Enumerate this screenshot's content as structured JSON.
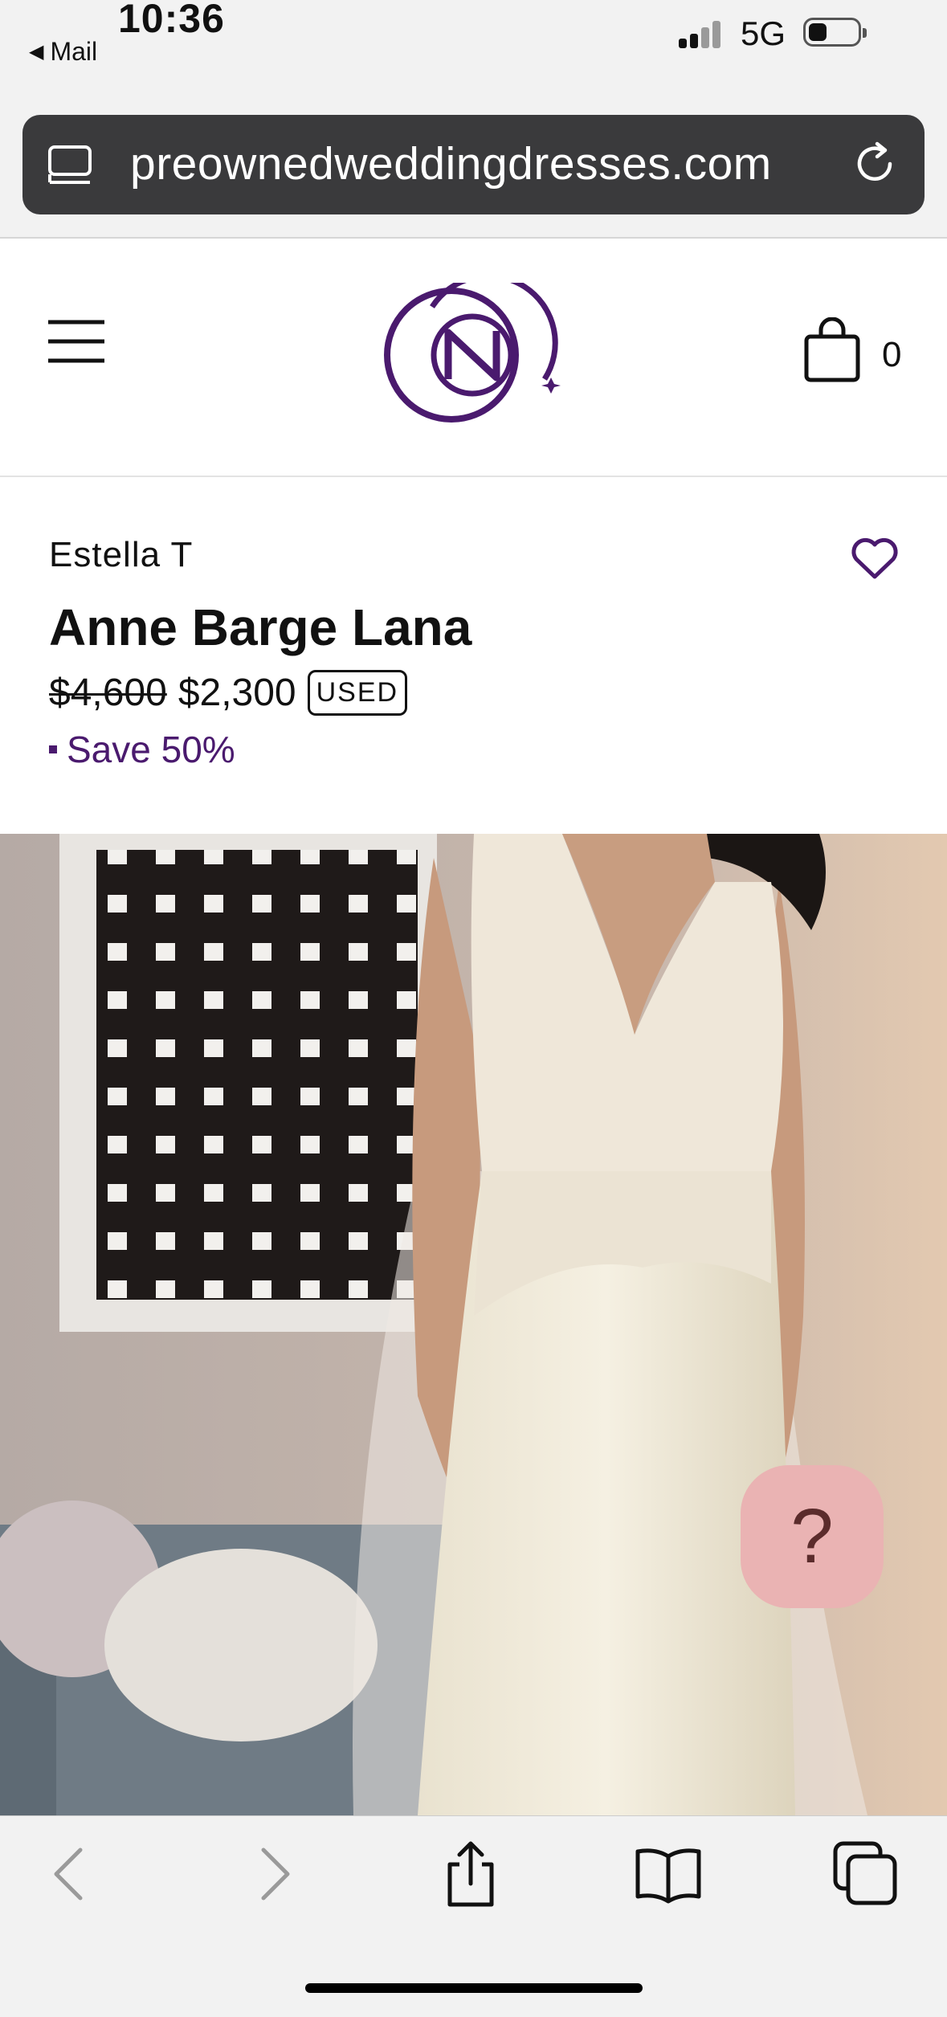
{
  "status_bar": {
    "time": "10:36",
    "back_app": "Mail",
    "network": "5G"
  },
  "url_bar": {
    "domain": "preownedweddingdresses.com"
  },
  "header": {
    "cart_count": "0",
    "brand_color": "#4a1a6e"
  },
  "product": {
    "designer": "Estella T",
    "title": "Anne Barge Lana",
    "original_price": "$4,600",
    "sale_price": "$2,300",
    "condition_badge": "USED",
    "savings": "Save 50%"
  },
  "help": {
    "label": "?"
  },
  "icons": {
    "menu": "hamburger-icon",
    "cart": "shopping-bag-icon",
    "favorite": "heart-icon",
    "reader": "reader-mode-icon",
    "reload": "reload-icon",
    "back": "chevron-left-icon",
    "forward": "chevron-right-icon",
    "share": "share-icon",
    "bookmarks": "book-icon",
    "tabs": "tabs-icon"
  }
}
